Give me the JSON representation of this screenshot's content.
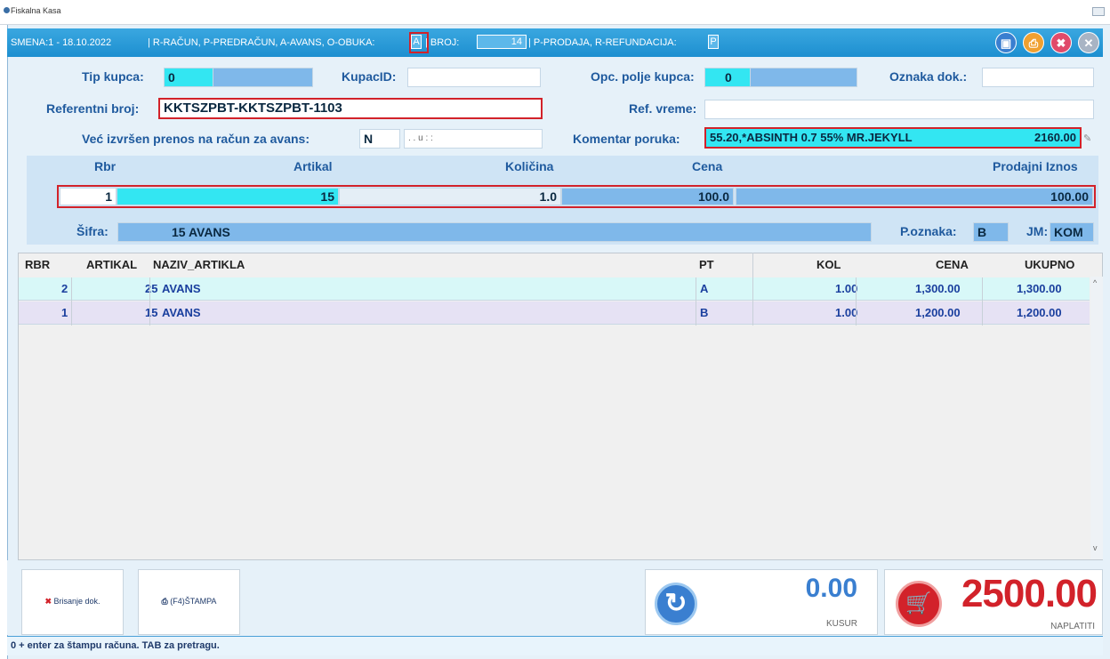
{
  "window": {
    "title": "Fiskalna Kasa"
  },
  "shift_bar": {
    "shift": "SMENA:1 - 18.10.2022",
    "doc_types": "| R-RAČUN, P-PREDRAČUN, A-AVANS, O-OBUKA:",
    "doc_type_value": "A",
    "broj_label": "| BROJ:",
    "broj_value": "14",
    "sale_types": "| P-PRODAJA, R-REFUNDACIJA:",
    "sale_type_value": "P"
  },
  "form": {
    "tip_kupca_label": "Tip kupca:",
    "tip_kupca_value": "0",
    "kupacid_label": "KupacID:",
    "kupacid_value": "",
    "opc_polje_label": "Opc. polje kupca:",
    "opc_polje_value": "0",
    "oznaka_dok_label": "Oznaka dok.:",
    "oznaka_dok_value": "",
    "ref_broj_label": "Referentni broj:",
    "ref_broj_value": "KKTSZPBT-KKTSZPBT-1103",
    "ref_vreme_label": "Ref. vreme:",
    "ref_vreme_value": "",
    "vec_izvrsen_label": "Već izvršen prenos na račun za avans:",
    "vec_izvrsen_value": "N",
    "date_time_mask": ". .   u : :",
    "komentar_label": "Komentar poruka:",
    "komentar_value": "55.20,*ABSINTH 0.7 55% MR.JEKYLL",
    "komentar_amount": "2160.00"
  },
  "entry": {
    "headers": {
      "rbr": "Rbr",
      "artikal": "Artikal",
      "kolicina": "Količina",
      "cena": "Cena",
      "prodajni": "Prodajni Iznos"
    },
    "rbr": "1",
    "artikal": "15",
    "kolicina": "1.0",
    "cena": "100.0",
    "prodajni": "100.00",
    "sifra_label": "Šifra:",
    "sifra_value": "15 AVANS",
    "poznaka_label": "P.oznaka:",
    "poznaka_value": "B",
    "jm_label": "JM:",
    "jm_value": "KOM"
  },
  "table": {
    "columns": [
      "RBR",
      "ARTIKAL",
      "NAZIV_ARTIKLA",
      "PT",
      "KOL",
      "CENA",
      "UKUPNO"
    ],
    "rows": [
      {
        "rbr": "2",
        "artikal": "25",
        "naziv": "AVANS",
        "pt": "A",
        "kol": "1.00",
        "cena": "1,300.00",
        "ukupno": "1,300.00"
      },
      {
        "rbr": "1",
        "artikal": "15",
        "naziv": "AVANS",
        "pt": "B",
        "kol": "1.00",
        "cena": "1,200.00",
        "ukupno": "1,200.00"
      }
    ]
  },
  "buttons": {
    "brisanje": "Brisanje dok.",
    "stampa": "(F4)ŠTAMPA"
  },
  "totals": {
    "kusur_value": "0.00",
    "kusur_label": "KUSUR",
    "naplatiti_value": "2500.00",
    "naplatiti_label": "NAPLATITI"
  },
  "status": "0 + enter za štampu računa. TAB za pretragu.",
  "icons": {
    "save": "save-icon",
    "print": "print-icon",
    "delete": "trash-icon",
    "close": "close-icon",
    "refresh": "refresh-icon",
    "cart": "cart-icon"
  },
  "colors": {
    "accent_blue": "#1d8fd0",
    "cyan": "#33e6f2",
    "red": "#d2222a",
    "total_red": "#d2222a"
  }
}
